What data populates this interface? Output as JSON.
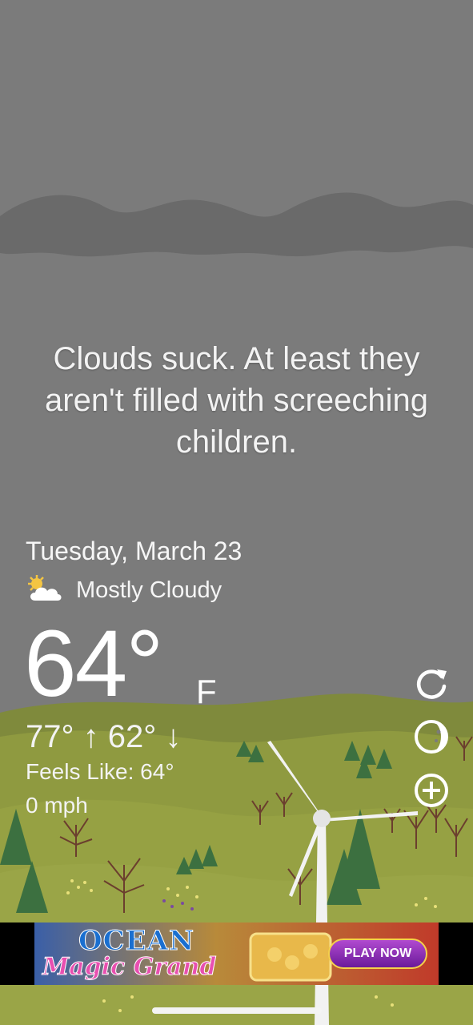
{
  "tagline": "Clouds suck. At least they aren't filled with screeching children.",
  "date": "Tuesday, March 23",
  "condition": {
    "icon": "partly-cloudy-icon",
    "text": "Mostly Cloudy"
  },
  "temperature": {
    "value": "64°",
    "unit": "F"
  },
  "hi_lo": "77° ↑  62° ↓",
  "feels_like": "Feels Like: 64°",
  "wind": "0 mph",
  "controls": {
    "refresh": "refresh-icon",
    "moon": "moon-phase-icon",
    "add": "add-location-icon"
  },
  "ad": {
    "title": "OCEAN",
    "subtitle": "Magic Grand",
    "cta": "PLAY NOW"
  },
  "colors": {
    "sky": "#7b7b7b",
    "cloud_band": "#6a6a6a",
    "hills": "#8f9a3e",
    "ground": "#9aa443",
    "trees": "#3f7a3a",
    "ad_cta": "#8a2fb8"
  }
}
